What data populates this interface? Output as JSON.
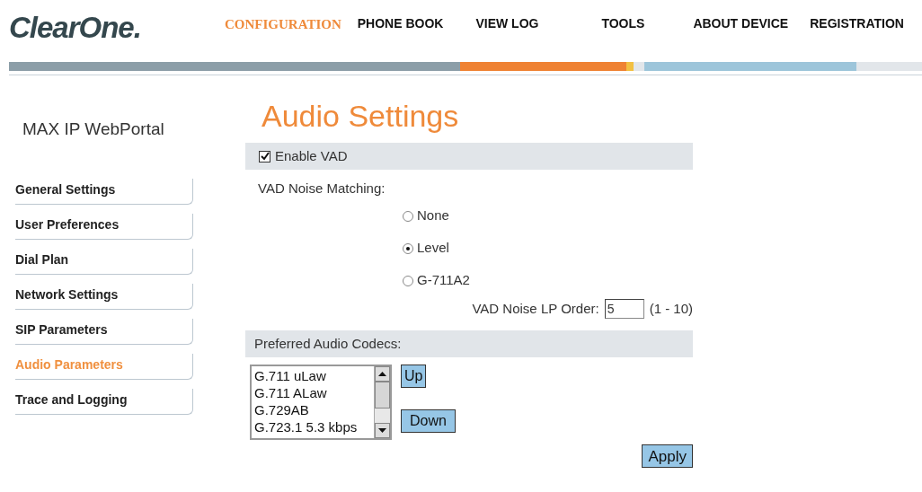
{
  "logo": "ClearOne.",
  "nav": [
    {
      "label": "CONFIGURATION",
      "selected": true
    },
    {
      "label": "PHONE BOOK",
      "selected": false
    },
    {
      "label": "VIEW LOG",
      "selected": false
    },
    {
      "label": "TOOLS",
      "selected": false
    },
    {
      "label": "ABOUT DEVICE",
      "selected": false
    },
    {
      "label": "REGISTRATION",
      "selected": false
    }
  ],
  "sidebar": {
    "title": "MAX IP WebPortal",
    "items": [
      {
        "label": "General Settings",
        "selected": false
      },
      {
        "label": "User Preferences",
        "selected": false
      },
      {
        "label": "Dial Plan",
        "selected": false
      },
      {
        "label": "Network Settings",
        "selected": false
      },
      {
        "label": "SIP Parameters",
        "selected": false
      },
      {
        "label": "Audio Parameters",
        "selected": true
      },
      {
        "label": "Trace and Logging",
        "selected": false
      }
    ]
  },
  "page_title": "Audio Settings",
  "enable_vad": {
    "label": "Enable VAD",
    "checked": true
  },
  "noise_matching": {
    "label": "VAD Noise Matching:",
    "options": [
      {
        "label": "None",
        "selected": false
      },
      {
        "label": "Level",
        "selected": true
      },
      {
        "label": "G-711A2",
        "selected": false
      }
    ]
  },
  "lp_order": {
    "label": "VAD Noise LP Order:",
    "value": "5",
    "range": "(1 - 10)"
  },
  "codecs": {
    "label": "Preferred Audio Codecs:",
    "items": [
      "G.711 uLaw",
      "G.711 ALaw",
      "G.729AB",
      "G.723.1 5.3 kbps"
    ],
    "up": "Up",
    "down": "Down"
  },
  "apply": "Apply"
}
